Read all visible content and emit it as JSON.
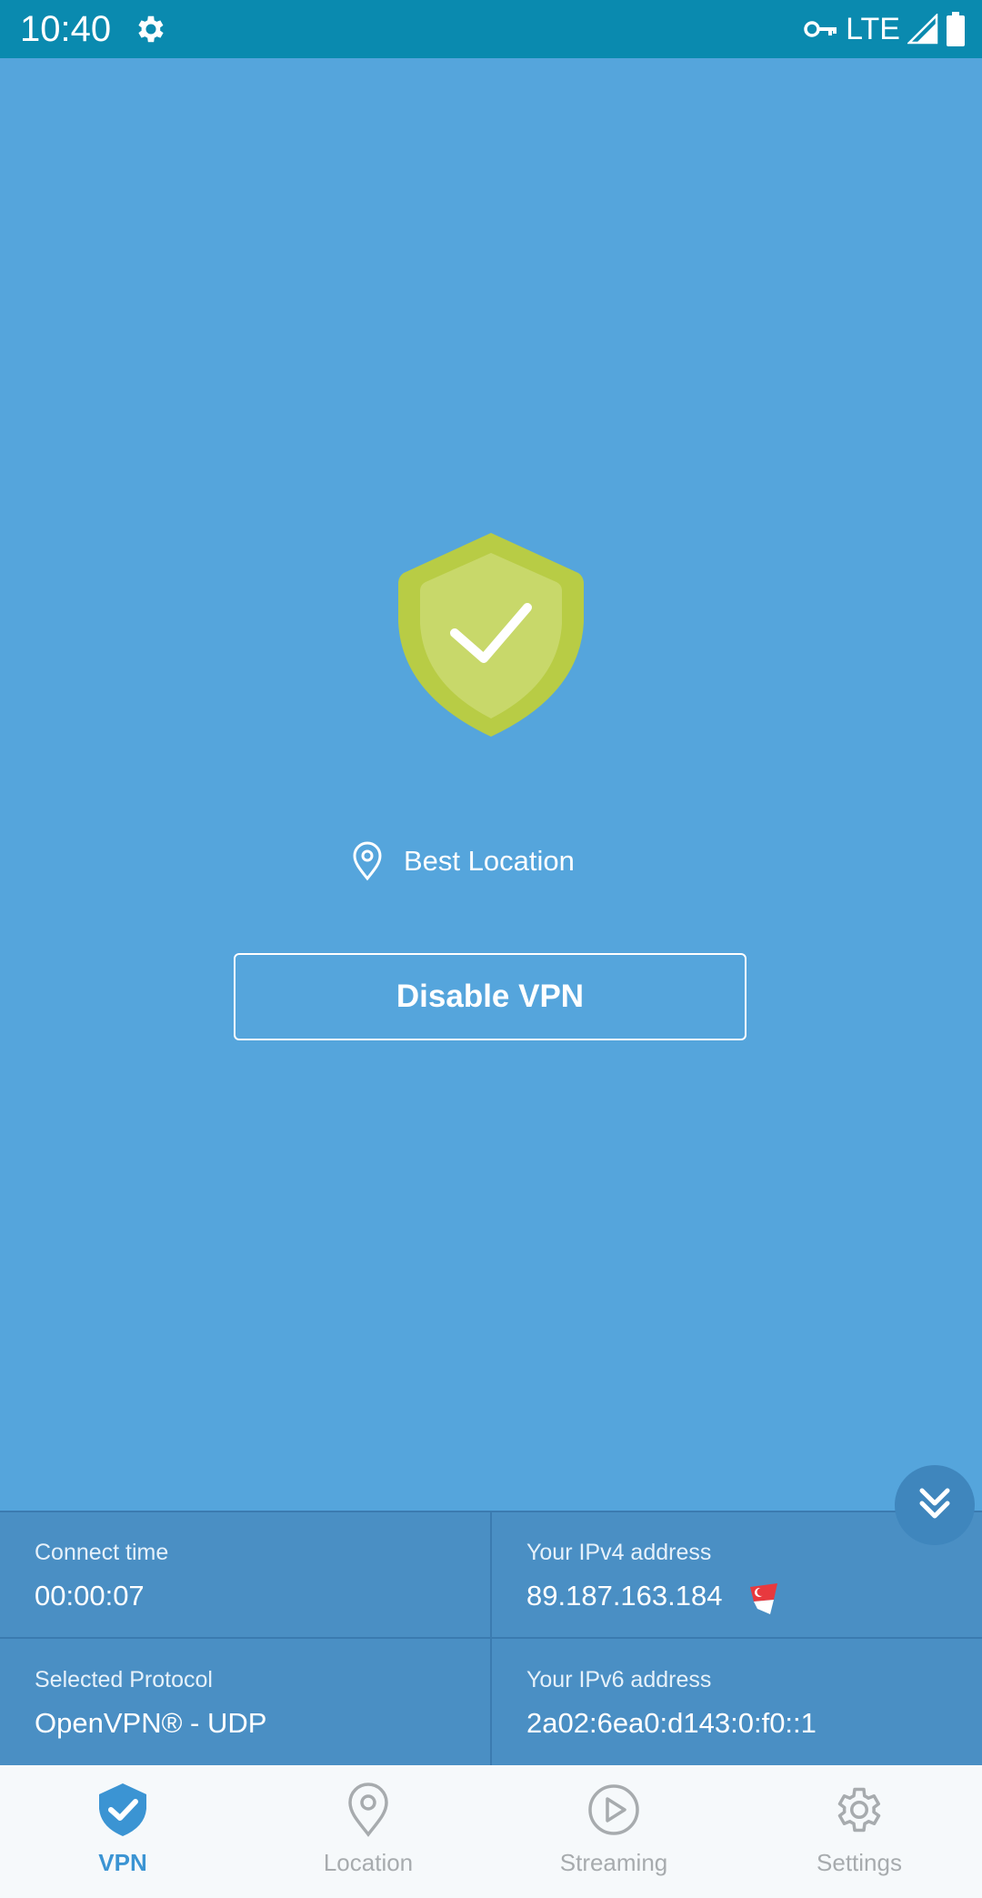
{
  "status_bar": {
    "time": "10:40",
    "network": "LTE",
    "icons": [
      "settings-gear-icon",
      "vpn-key-icon",
      "signal-icon",
      "battery-icon"
    ]
  },
  "main": {
    "status_icon": "shield-check-icon",
    "location_label": "Best Location",
    "disable_button": "Disable VPN"
  },
  "info": {
    "connect_time_label": "Connect time",
    "connect_time_value": "00:00:07",
    "ipv4_label": "Your IPv4 address",
    "ipv4_value": "89.187.163.184",
    "ipv4_flag": "singapore-flag-icon",
    "protocol_label": "Selected Protocol",
    "protocol_value": "OpenVPN® - UDP",
    "ipv6_label": "Your IPv6 address",
    "ipv6_value": "2a02:6ea0:d143:0:f0::1"
  },
  "bottom_nav": {
    "items": [
      {
        "label": "VPN",
        "icon": "shield-check-icon",
        "active": true
      },
      {
        "label": "Location",
        "icon": "map-pin-icon",
        "active": false
      },
      {
        "label": "Streaming",
        "icon": "play-circle-icon",
        "active": false
      },
      {
        "label": "Settings",
        "icon": "gear-icon",
        "active": false
      }
    ]
  },
  "colors": {
    "background": "#55a5dc",
    "status_bar": "#0a8aaf",
    "shield_outer": "#b8cc45",
    "shield_inner": "#c8d86a",
    "info_panel": "#4a8fc4",
    "nav_active": "#3b94d3",
    "nav_inactive": "#a7abae"
  }
}
